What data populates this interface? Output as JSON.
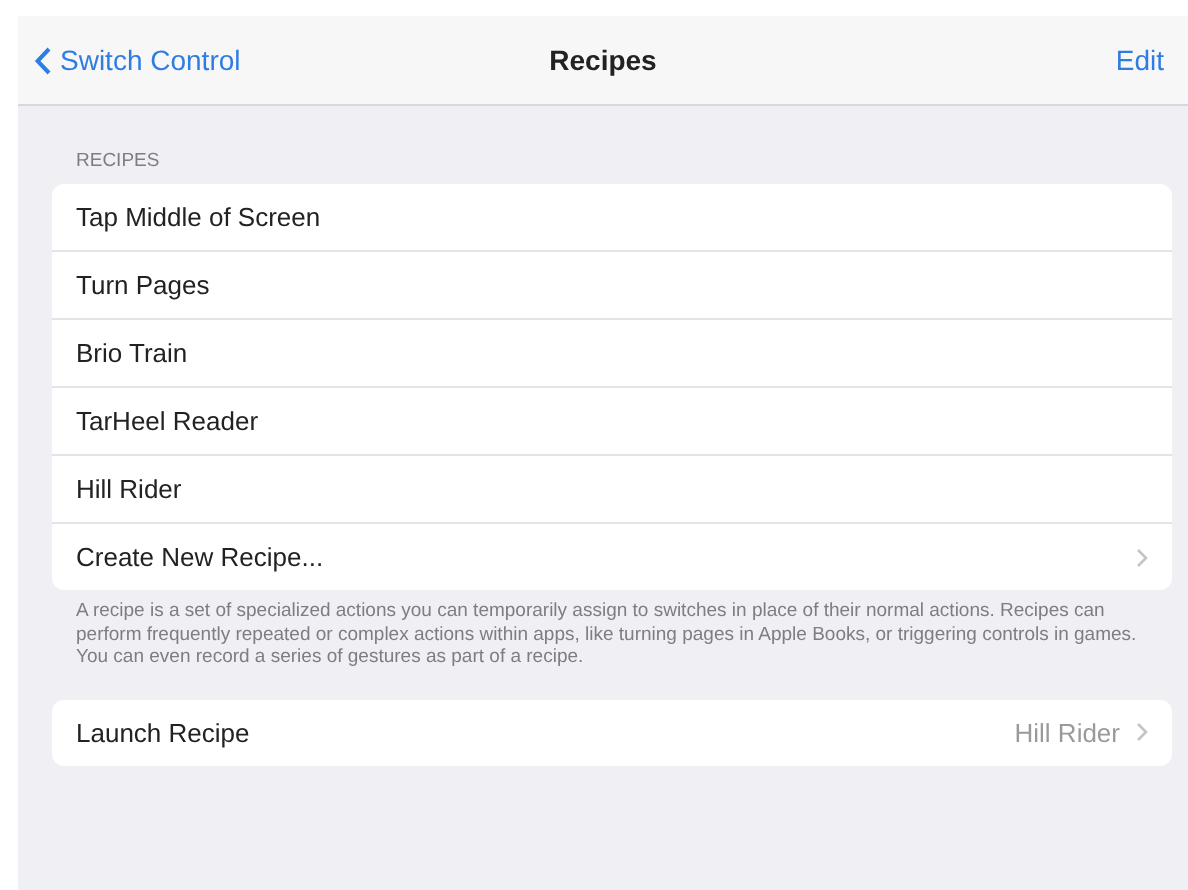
{
  "nav_bar": {
    "back_label": "Switch Control",
    "title": "Recipes",
    "action": "Edit"
  },
  "recipes_section": {
    "header": "RECIPES",
    "rows": [
      {
        "label": "Tap Middle of Screen",
        "kind": "plain"
      },
      {
        "label": "Turn Pages",
        "kind": "plain"
      },
      {
        "label": "Brio Train",
        "kind": "plain"
      },
      {
        "label": "TarHeel Reader",
        "kind": "plain"
      },
      {
        "label": "Hill Rider",
        "kind": "plain"
      },
      {
        "label": "Create New Recipe...",
        "kind": "disclosure"
      }
    ],
    "footer": "A recipe is a set of specialized actions you can temporarily assign to switches in place of their normal actions. Recipes can perform frequently repeated or complex actions within apps, like turning pages in Apple Books, or triggering controls in games. You can even record a series of gestures as part of a recipe."
  },
  "launch_section": {
    "rows": [
      {
        "label": "Launch Recipe",
        "value": "Hill Rider",
        "kind": "disclosure"
      }
    ]
  }
}
